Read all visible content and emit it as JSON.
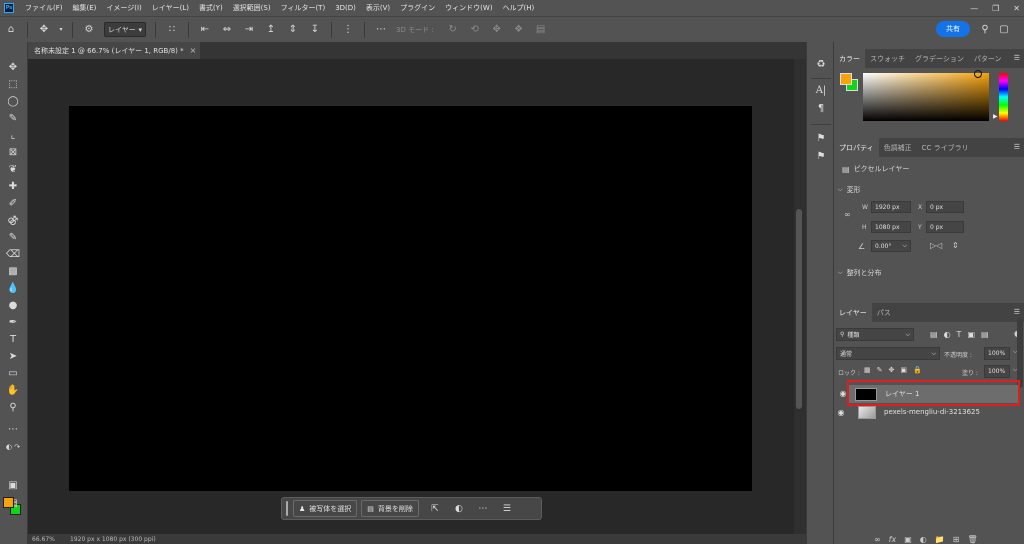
{
  "menubar": {
    "logo": "Ps",
    "items": [
      "ファイル(F)",
      "編集(E)",
      "イメージ(I)",
      "レイヤー(L)",
      "書式(Y)",
      "選択範囲(S)",
      "フィルター(T)",
      "3D(D)",
      "表示(V)",
      "プラグイン",
      "ウィンドウ(W)",
      "ヘルプ(H)"
    ]
  },
  "options": {
    "layer_select": "レイヤー",
    "mode3d": "3D モード :",
    "share": "共有"
  },
  "document": {
    "tab_title": "名称未設定 1 @ 66.7% (レイヤー 1, RGB/8) *",
    "zoom": "66.67%",
    "info": "1920 px x 1080 px (300 ppi)"
  },
  "colors": {
    "foreground": "#f7a30c",
    "background": "#12d318",
    "accent": "#1473e6",
    "highlight": "#e21d1d"
  },
  "taskbar": {
    "select_subject": "被写体を選択",
    "remove_bg": "背景を削除"
  },
  "color_panel": {
    "tabs": [
      "カラー",
      "スウォッチ",
      "グラデーション",
      "パターン"
    ]
  },
  "properties_panel": {
    "tabs": [
      "プロパティ",
      "色調補正",
      "CC ライブラリ"
    ],
    "kind": "ピクセルレイヤー",
    "transform_header": "変形",
    "w_label": "W",
    "w_value": "1920 px",
    "x_label": "X",
    "x_value": "0 px",
    "h_label": "H",
    "h_value": "1080 px",
    "y_label": "Y",
    "y_value": "0 px",
    "angle": "0.00°",
    "align_header": "整列と分布"
  },
  "layers_panel": {
    "tabs": [
      "レイヤー",
      "パス"
    ],
    "filter_kind": "種類",
    "blend_mode": "通常",
    "opacity_label": "不透明度 :",
    "opacity_value": "100%",
    "lock_label": "ロック :",
    "fill_label": "塗り :",
    "fill_value": "100%",
    "layers": [
      {
        "name": "レイヤー 1",
        "selected": true
      },
      {
        "name": "pexels-mengliu-di-3213625",
        "selected": false
      }
    ]
  }
}
